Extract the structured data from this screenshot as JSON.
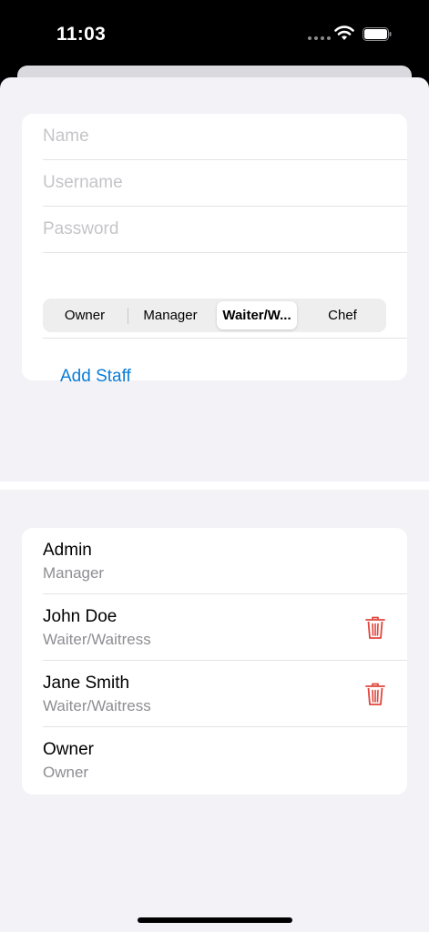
{
  "status": {
    "time": "11:03",
    "icons": [
      "signal-dots-icon",
      "wifi-icon",
      "battery-icon"
    ]
  },
  "form": {
    "name_placeholder": "Name",
    "username_placeholder": "Username",
    "password_placeholder": "Password",
    "roles": [
      "Owner",
      "Manager",
      "Waiter/W...",
      "Chef"
    ],
    "selected_role": "Waiter/W...",
    "add_label": "Add Staff"
  },
  "staff": [
    {
      "name": "Admin",
      "role": "Manager",
      "deletable": false
    },
    {
      "name": "John Doe",
      "role": "Waiter/Waitress",
      "deletable": true
    },
    {
      "name": "Jane Smith",
      "role": "Waiter/Waitress",
      "deletable": true
    },
    {
      "name": "Owner",
      "role": "Owner",
      "deletable": false
    }
  ],
  "colors": {
    "accent": "#0a7cd8",
    "destructive": "#e0463c",
    "background": "#f2f2f7",
    "secondary_text": "#8e8e93"
  }
}
